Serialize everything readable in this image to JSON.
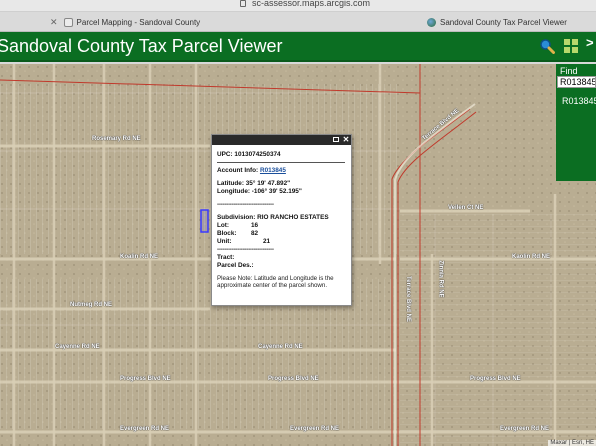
{
  "browser": {
    "url": "sc-assessor.maps.arcgis.com",
    "tabs": [
      {
        "label": "Parcel Mapping - Sandoval County"
      },
      {
        "label": "Sandoval County Tax Parcel Viewer"
      }
    ]
  },
  "header": {
    "title": "Sandoval County Tax Parcel Viewer",
    "icons": [
      "search-icon",
      "grid-icon",
      "more-icon"
    ],
    "bg_color": "#0b6e22"
  },
  "find": {
    "label": "Find",
    "input_value": "R013845",
    "result": "R013845"
  },
  "popup": {
    "upc": "UPC: 1013074250374",
    "account_label": "Account Info: ",
    "account_value": "R013845",
    "latitude": "Latitude: 35° 19' 47.892\"",
    "longitude": "Longitude: -106° 39' 52.195\"",
    "separator1": "-------------------------------",
    "subdivision": "Subdivision: RIO RANCHO ESTATES",
    "lot_label": "Lot:",
    "lot_value": "16",
    "block_label": "Block:",
    "block_value": "82",
    "unit_label": "Unit:",
    "unit_value": "21",
    "separator2": "-------------------------------",
    "tract": "Tract:",
    "parcel_des": "Parcel Des.:",
    "note": "Please Note: Latitude and Longitude is the approximate center of the parcel shown."
  },
  "map": {
    "attribution": "Maxar | Esri, HE",
    "road_labels": [
      "Rosemary Rd NE",
      "Koalin Rd NE",
      "Kaolin Rd NE",
      "Nutmeg Rd NE",
      "Cayenne Rd NE",
      "Cayenne Rd NE",
      "Progress Blvd NE",
      "Progress Blvd NE",
      "Progress Blvd NE",
      "Evergreen Rd NE",
      "Evergreen Rd NE",
      "Evergreen Rd NE",
      "Veilen Ct NE",
      "Terrace Blvd NE",
      "Terrace Blvd NE",
      "Zinnia Rd NE"
    ]
  }
}
